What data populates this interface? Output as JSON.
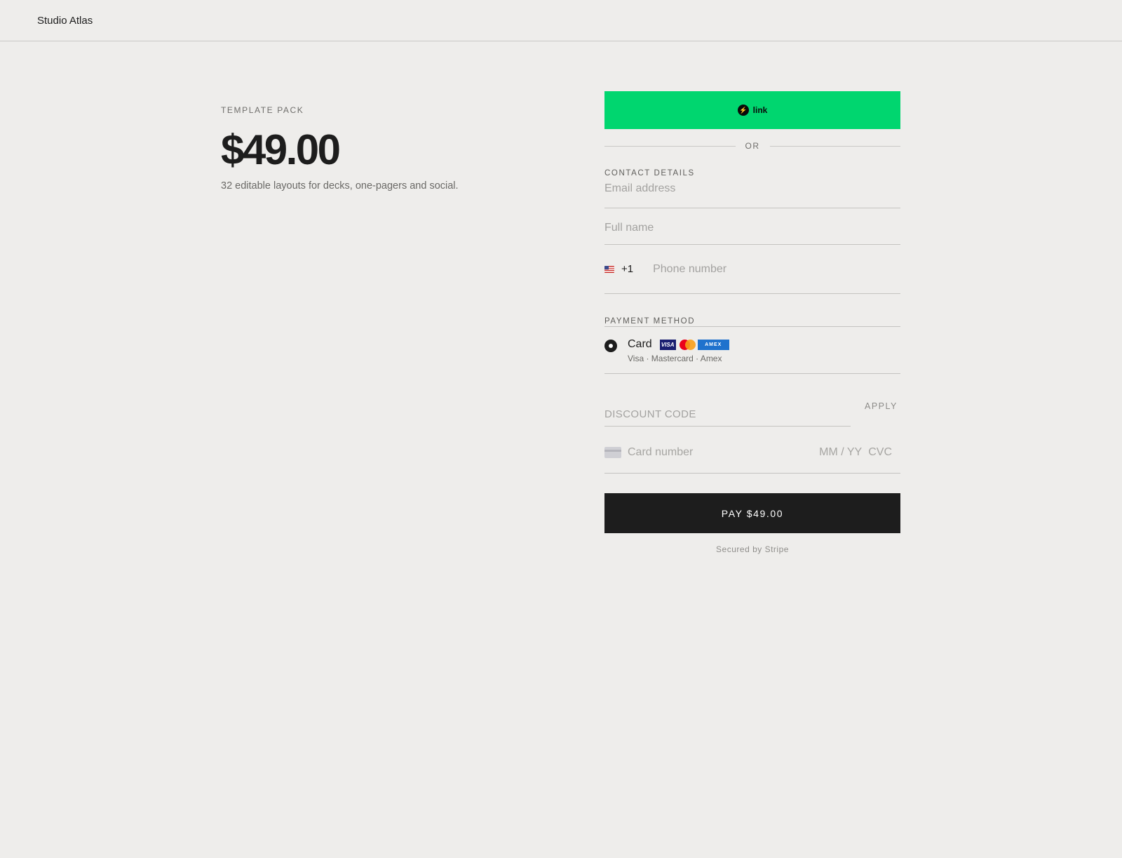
{
  "header": {
    "brand": "Studio Atlas"
  },
  "product": {
    "eyebrow": "TEMPLATE PACK",
    "price": "$49.00",
    "description": "32 editable layouts for decks, one-pagers and social."
  },
  "checkout": {
    "link_button": {
      "label": "link",
      "icon": "bolt-icon",
      "color": "#00d66f"
    },
    "divider_text": "OR",
    "contact": {
      "label": "CONTACT DETAILS",
      "email_placeholder": "Email address",
      "name_placeholder": "Full name",
      "phone": {
        "country_flag": "us-flag-icon",
        "country_code": "+1",
        "placeholder": "Phone number"
      }
    },
    "payment": {
      "label": "PAYMENT METHOD",
      "method": {
        "title": "Card",
        "selected": true,
        "subtitle": "Visa · Mastercard · Amex"
      },
      "brands": {
        "visa": "VISA",
        "amex": "AMEX"
      }
    },
    "discount": {
      "placeholder": "DISCOUNT CODE",
      "apply_label": "APPLY"
    },
    "card": {
      "number_placeholder": "Card number",
      "expiry_placeholder": "MM / YY",
      "cvc_placeholder": "CVC"
    },
    "pay_button": "PAY $49.00",
    "secured_text": "Secured by Stripe",
    "colors": {
      "accent": "#00d66f",
      "primary": "#1d1d1d",
      "background": "#eeedeb"
    }
  }
}
